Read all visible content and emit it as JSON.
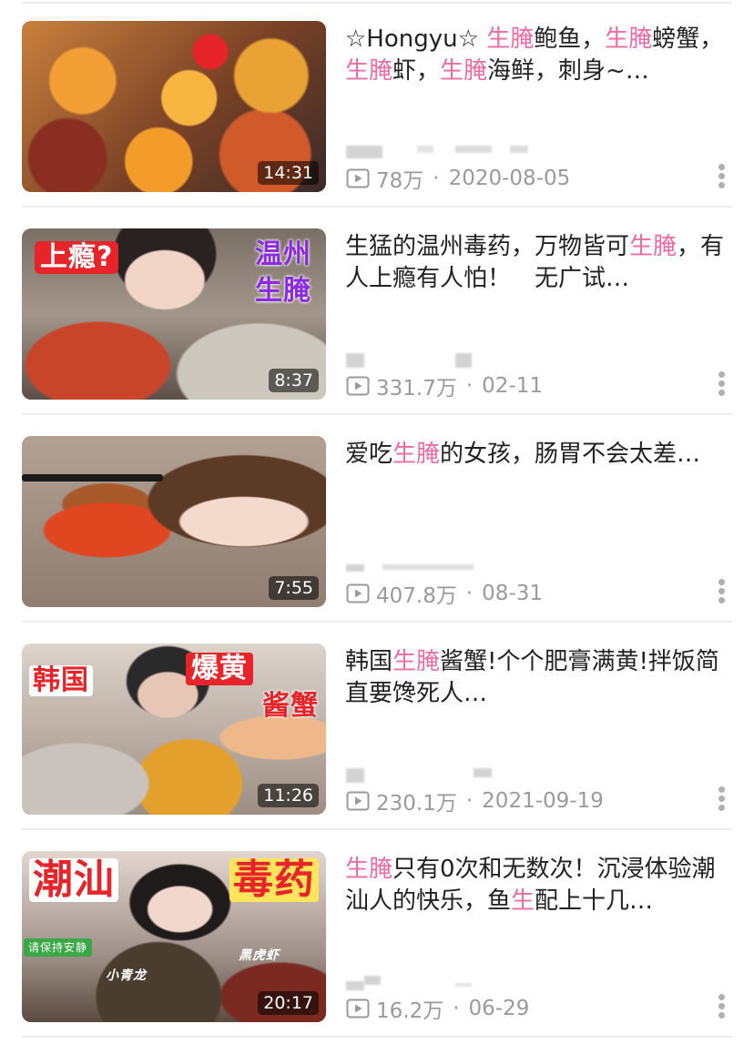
{
  "videos": [
    {
      "title_parts": [
        {
          "text": "☆Hongyu☆ ",
          "hl": false
        },
        {
          "text": "生腌",
          "hl": true
        },
        {
          "text": "鲍鱼，",
          "hl": false
        },
        {
          "text": "生腌",
          "hl": true
        },
        {
          "text": "螃蟹，",
          "hl": false
        },
        {
          "text": "生腌",
          "hl": true
        },
        {
          "text": "虾，",
          "hl": false
        },
        {
          "text": "生腌",
          "hl": true
        },
        {
          "text": "海鲜，刺身~…",
          "hl": false
        }
      ],
      "views": "78万",
      "date": "2020-08-05",
      "duration": "14:31",
      "overlays": []
    },
    {
      "title_parts": [
        {
          "text": "生猛的温州毒药，万物皆可",
          "hl": false
        },
        {
          "text": "生腌",
          "hl": true
        },
        {
          "text": "，有人上瘾有人怕！　无广试…",
          "hl": false
        }
      ],
      "views": "331.7万",
      "date": "02-11",
      "duration": "8:37",
      "overlays": [
        "上瘾?",
        "温州",
        "生腌"
      ]
    },
    {
      "title_parts": [
        {
          "text": "爱吃",
          "hl": false
        },
        {
          "text": "生腌",
          "hl": true
        },
        {
          "text": "的女孩，肠胃不会太差…",
          "hl": false
        }
      ],
      "views": "407.8万",
      "date": "08-31",
      "duration": "7:55",
      "overlays": []
    },
    {
      "title_parts": [
        {
          "text": "韩国",
          "hl": false
        },
        {
          "text": "生腌",
          "hl": true
        },
        {
          "text": "酱蟹!个个肥膏满黄!拌饭简直要馋死人…",
          "hl": false
        }
      ],
      "views": "230.1万",
      "date": "2021-09-19",
      "duration": "11:26",
      "overlays": [
        "韩国",
        "爆黄",
        "酱蟹"
      ]
    },
    {
      "title_parts": [
        {
          "text": "生腌",
          "hl": true
        },
        {
          "text": "只有0次和无数次！沉浸体验潮汕人的快乐，鱼",
          "hl": false
        },
        {
          "text": "生",
          "hl": true
        },
        {
          "text": "配上十几…",
          "hl": false
        }
      ],
      "views": "16.2万",
      "date": "06-29",
      "duration": "20:17",
      "overlays": [
        "潮汕",
        "毒药",
        "请保持安静",
        "小青龙",
        "黑虎虾"
      ]
    }
  ],
  "icons": {
    "views": "play-square-icon",
    "more": "vertical-dots-icon"
  },
  "colors": {
    "highlight": "#ee6ba3",
    "title_text": "#222222",
    "meta_text": "#9a9a9a",
    "divider": "#ececec",
    "thumb_overlay_red": "#e8242b",
    "thumb_overlay_purple": "#8a2be2"
  }
}
